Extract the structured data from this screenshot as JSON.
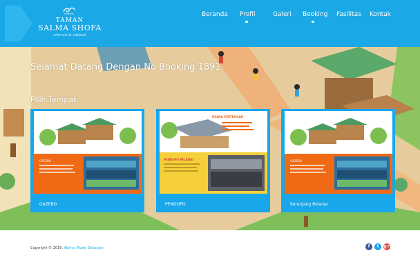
{
  "brand": {
    "line1": "TAMAN",
    "line2": "SALMA SHOFA",
    "tagline": "rekreasi & edukasi"
  },
  "nav": [
    {
      "label": "Beranda",
      "has_dropdown": false
    },
    {
      "label": "Profil",
      "has_dropdown": true
    },
    {
      "label": "Galeri",
      "has_dropdown": false
    },
    {
      "label": "Booking",
      "has_dropdown": true
    },
    {
      "label": "Fasilitas",
      "has_dropdown": false
    },
    {
      "label": "Kontak",
      "has_dropdown": false
    }
  ],
  "hero": {
    "welcome": "Selamat Datang Dengan No Booking 1891",
    "choose_label": "Pilih Tempat"
  },
  "cards": [
    {
      "caption": "GAZEBO",
      "panel_text": "GAZEBO"
    },
    {
      "caption": "PENDOPO",
      "panel_title": "RUANG PERTEMUAN",
      "panel_text": "PENDOPO PELANGI"
    },
    {
      "caption": "Keranjang Belanja",
      "panel_text": "GAZEBO"
    }
  ],
  "footer": {
    "copyright": "Copyright © 2016,",
    "author": "Wahyu Rizski Setiawan"
  },
  "social": [
    {
      "icon": "facebook-icon",
      "glyph": "f",
      "color": "#3b5998"
    },
    {
      "icon": "twitter-icon",
      "glyph": "t",
      "color": "#1da1f2"
    },
    {
      "icon": "google-plus-icon",
      "glyph": "g+",
      "color": "#dd4b39"
    }
  ],
  "colors": {
    "header": "#1aa8e6",
    "card": "#18a7ea",
    "accent_orange": "#f06a16",
    "accent_yellow": "#f4cf3a"
  }
}
